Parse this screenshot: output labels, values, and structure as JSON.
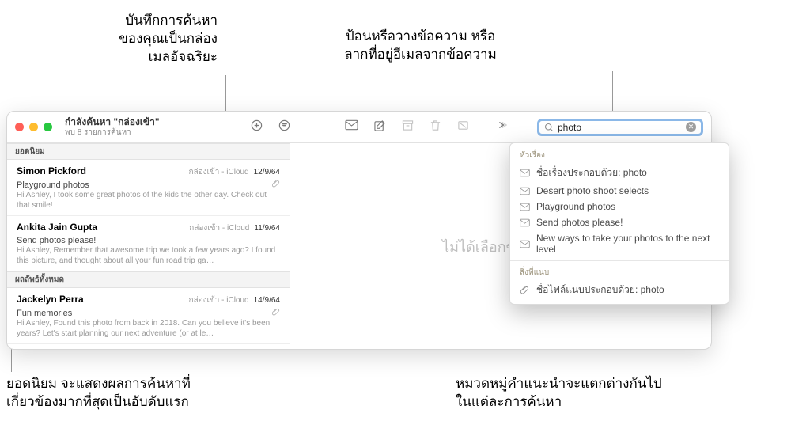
{
  "callouts": {
    "saveSmart": "บันทึกการค้นหา\nของคุณเป็นกล่อง\nเมลอัจฉริยะ",
    "enterPaste": "ป้อนหรือวางข้อความ หรือ\nลากที่อยู่อีเมลจากข้อความ",
    "topHits": "ยอดนิยม จะแสดงผลการค้นหาที่\nเกี่ยวข้องมากที่สุดเป็นอับดับแรก",
    "categories": "หมวดหมู่คำแนะนำจะแตกต่างกันไป\nในแต่ละการค้นหา"
  },
  "window": {
    "title": "กำลังค้นหา \"กล่องเข้า\"",
    "subtitle": "พบ 8 รายการค้นหา",
    "search_value": "photo"
  },
  "sections": {
    "top": "ยอดนิยม",
    "all": "ผลลัพธ์ทั้งหมด"
  },
  "messages": [
    {
      "sender": "Simon Pickford",
      "mailbox": "กล่องเข้า - iCloud",
      "date": "12/9/64",
      "subject": "Playground photos",
      "preview": "Hi Ashley, I took some great photos of the kids the other day. Check out that smile!",
      "attach": true
    },
    {
      "sender": "Ankita Jain Gupta",
      "mailbox": "กล่องเข้า - iCloud",
      "date": "11/9/64",
      "subject": "Send photos please!",
      "preview": "Hi Ashley, Remember that awesome trip we took a few years ago? I found this picture, and thought about all your fun road trip ga…",
      "attach": false
    },
    {
      "sender": "Jackelyn Perra",
      "mailbox": "กล่องเข้า - iCloud",
      "date": "14/9/64",
      "subject": "Fun memories",
      "preview": "Hi Ashley, Found this photo from back in 2018. Can you believe it's been years? Let's start planning our next adventure (or at le…",
      "attach": true
    }
  ],
  "main_placeholder": "ไม่ได้เลือกข้อความ",
  "suggestions": {
    "subject_head": "หัวเรื่อง",
    "subject_items": [
      "ชื่อเรื่องประกอบด้วย: photo",
      "Desert photo shoot selects",
      "Playground photos",
      "Send photos please!",
      "New ways to take your photos to the next level"
    ],
    "attach_head": "สิ่งที่แนบ",
    "attach_items": [
      "ชื่อไฟล์แนบประกอบด้วย: photo"
    ]
  }
}
